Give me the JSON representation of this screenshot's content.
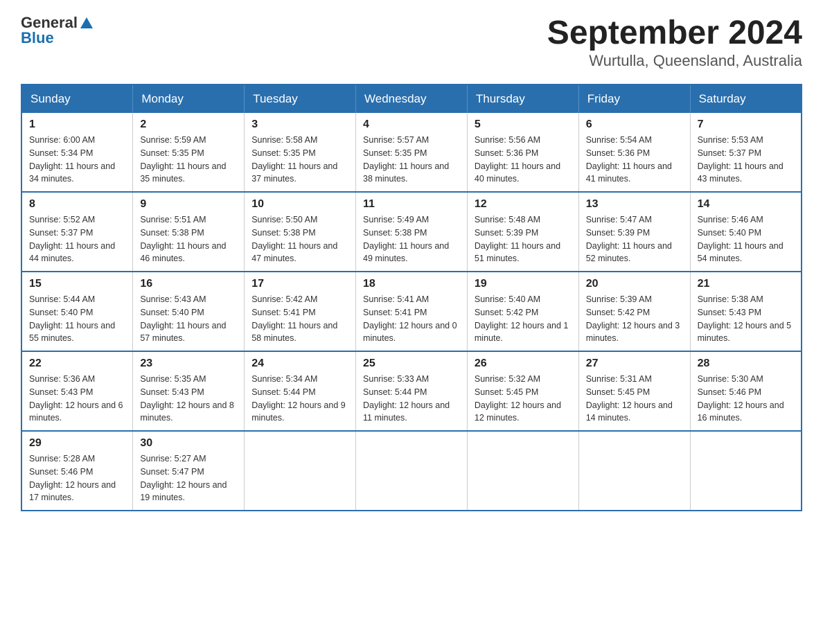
{
  "logo": {
    "general": "General",
    "blue": "Blue"
  },
  "title": "September 2024",
  "location": "Wurtulla, Queensland, Australia",
  "days_of_week": [
    "Sunday",
    "Monday",
    "Tuesday",
    "Wednesday",
    "Thursday",
    "Friday",
    "Saturday"
  ],
  "weeks": [
    [
      {
        "day": "1",
        "sunrise": "6:00 AM",
        "sunset": "5:34 PM",
        "daylight": "11 hours and 34 minutes."
      },
      {
        "day": "2",
        "sunrise": "5:59 AM",
        "sunset": "5:35 PM",
        "daylight": "11 hours and 35 minutes."
      },
      {
        "day": "3",
        "sunrise": "5:58 AM",
        "sunset": "5:35 PM",
        "daylight": "11 hours and 37 minutes."
      },
      {
        "day": "4",
        "sunrise": "5:57 AM",
        "sunset": "5:35 PM",
        "daylight": "11 hours and 38 minutes."
      },
      {
        "day": "5",
        "sunrise": "5:56 AM",
        "sunset": "5:36 PM",
        "daylight": "11 hours and 40 minutes."
      },
      {
        "day": "6",
        "sunrise": "5:54 AM",
        "sunset": "5:36 PM",
        "daylight": "11 hours and 41 minutes."
      },
      {
        "day": "7",
        "sunrise": "5:53 AM",
        "sunset": "5:37 PM",
        "daylight": "11 hours and 43 minutes."
      }
    ],
    [
      {
        "day": "8",
        "sunrise": "5:52 AM",
        "sunset": "5:37 PM",
        "daylight": "11 hours and 44 minutes."
      },
      {
        "day": "9",
        "sunrise": "5:51 AM",
        "sunset": "5:38 PM",
        "daylight": "11 hours and 46 minutes."
      },
      {
        "day": "10",
        "sunrise": "5:50 AM",
        "sunset": "5:38 PM",
        "daylight": "11 hours and 47 minutes."
      },
      {
        "day": "11",
        "sunrise": "5:49 AM",
        "sunset": "5:38 PM",
        "daylight": "11 hours and 49 minutes."
      },
      {
        "day": "12",
        "sunrise": "5:48 AM",
        "sunset": "5:39 PM",
        "daylight": "11 hours and 51 minutes."
      },
      {
        "day": "13",
        "sunrise": "5:47 AM",
        "sunset": "5:39 PM",
        "daylight": "11 hours and 52 minutes."
      },
      {
        "day": "14",
        "sunrise": "5:46 AM",
        "sunset": "5:40 PM",
        "daylight": "11 hours and 54 minutes."
      }
    ],
    [
      {
        "day": "15",
        "sunrise": "5:44 AM",
        "sunset": "5:40 PM",
        "daylight": "11 hours and 55 minutes."
      },
      {
        "day": "16",
        "sunrise": "5:43 AM",
        "sunset": "5:40 PM",
        "daylight": "11 hours and 57 minutes."
      },
      {
        "day": "17",
        "sunrise": "5:42 AM",
        "sunset": "5:41 PM",
        "daylight": "11 hours and 58 minutes."
      },
      {
        "day": "18",
        "sunrise": "5:41 AM",
        "sunset": "5:41 PM",
        "daylight": "12 hours and 0 minutes."
      },
      {
        "day": "19",
        "sunrise": "5:40 AM",
        "sunset": "5:42 PM",
        "daylight": "12 hours and 1 minute."
      },
      {
        "day": "20",
        "sunrise": "5:39 AM",
        "sunset": "5:42 PM",
        "daylight": "12 hours and 3 minutes."
      },
      {
        "day": "21",
        "sunrise": "5:38 AM",
        "sunset": "5:43 PM",
        "daylight": "12 hours and 5 minutes."
      }
    ],
    [
      {
        "day": "22",
        "sunrise": "5:36 AM",
        "sunset": "5:43 PM",
        "daylight": "12 hours and 6 minutes."
      },
      {
        "day": "23",
        "sunrise": "5:35 AM",
        "sunset": "5:43 PM",
        "daylight": "12 hours and 8 minutes."
      },
      {
        "day": "24",
        "sunrise": "5:34 AM",
        "sunset": "5:44 PM",
        "daylight": "12 hours and 9 minutes."
      },
      {
        "day": "25",
        "sunrise": "5:33 AM",
        "sunset": "5:44 PM",
        "daylight": "12 hours and 11 minutes."
      },
      {
        "day": "26",
        "sunrise": "5:32 AM",
        "sunset": "5:45 PM",
        "daylight": "12 hours and 12 minutes."
      },
      {
        "day": "27",
        "sunrise": "5:31 AM",
        "sunset": "5:45 PM",
        "daylight": "12 hours and 14 minutes."
      },
      {
        "day": "28",
        "sunrise": "5:30 AM",
        "sunset": "5:46 PM",
        "daylight": "12 hours and 16 minutes."
      }
    ],
    [
      {
        "day": "29",
        "sunrise": "5:28 AM",
        "sunset": "5:46 PM",
        "daylight": "12 hours and 17 minutes."
      },
      {
        "day": "30",
        "sunrise": "5:27 AM",
        "sunset": "5:47 PM",
        "daylight": "12 hours and 19 minutes."
      },
      null,
      null,
      null,
      null,
      null
    ]
  ],
  "labels": {
    "sunrise": "Sunrise:",
    "sunset": "Sunset:",
    "daylight": "Daylight:"
  }
}
